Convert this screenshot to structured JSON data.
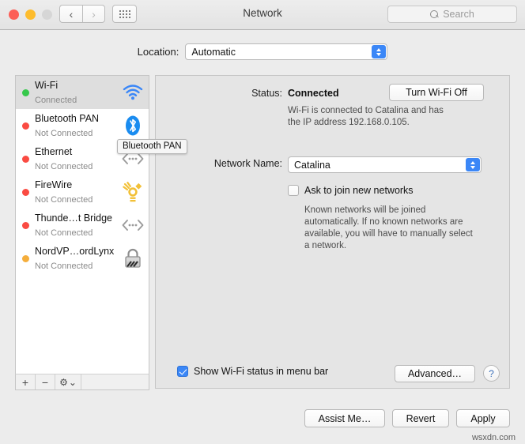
{
  "window": {
    "title": "Network",
    "traffic_lights": [
      "close",
      "minimize",
      "zoom"
    ],
    "nav_back": "‹",
    "nav_forward": "›",
    "grid_icon": "grid-icon"
  },
  "search": {
    "placeholder": "Search",
    "icon": "search-icon"
  },
  "location": {
    "label": "Location:",
    "value": "Automatic"
  },
  "sidebar": {
    "services": [
      {
        "name": "Wi-Fi",
        "state": "Connected",
        "dot": "#36c84b",
        "icon": "wifi-icon",
        "selected": true
      },
      {
        "name": "Bluetooth PAN",
        "state": "Not Connected",
        "dot": "#fa4b42",
        "icon": "bluetooth-icon",
        "selected": false
      },
      {
        "name": "Ethernet",
        "state": "Not Connected",
        "dot": "#fa4b42",
        "icon": "ethernet-icon",
        "selected": false
      },
      {
        "name": "FireWire",
        "state": "Not Connected",
        "dot": "#fa4b42",
        "icon": "firewire-icon",
        "selected": false
      },
      {
        "name": "Thunde…t Bridge",
        "state": "Not Connected",
        "dot": "#fa4b42",
        "icon": "bridge-icon",
        "selected": false
      },
      {
        "name": "NordVP…ordLynx",
        "state": "Not Connected",
        "dot": "#f5ae3c",
        "icon": "vpn-lock-icon",
        "selected": false
      }
    ],
    "footer": {
      "add": "+",
      "remove": "−",
      "gear": "⚙",
      "gear_chevron": "⌄"
    }
  },
  "tooltip": {
    "text": "Bluetooth PAN"
  },
  "panel": {
    "status_label": "Status:",
    "status_value": "Connected",
    "status_description": "Wi-Fi is connected to Catalina and has the IP address 192.168.0.105.",
    "turn_off_button": "Turn Wi-Fi Off",
    "network_name_label": "Network Name:",
    "network_name_value": "Catalina",
    "ask_join_label": "Ask to join new networks",
    "ask_join_checked": false,
    "ask_join_hint": "Known networks will be joined automatically. If no known networks are available, you will have to manually select a network.",
    "show_status_label": "Show Wi-Fi status in menu bar",
    "show_status_checked": true,
    "advanced_button": "Advanced…",
    "help_button": "?"
  },
  "footer": {
    "assist_me": "Assist Me…",
    "revert": "Revert",
    "apply": "Apply"
  },
  "watermark": "wsxdn.com",
  "colors": {
    "accent_blue": "#3b87f7",
    "green_dot": "#36c84b",
    "red_dot": "#fa4b42",
    "amber_dot": "#f5ae3c",
    "window_bg": "#ececec",
    "panel_bg": "#e5e5e5"
  }
}
